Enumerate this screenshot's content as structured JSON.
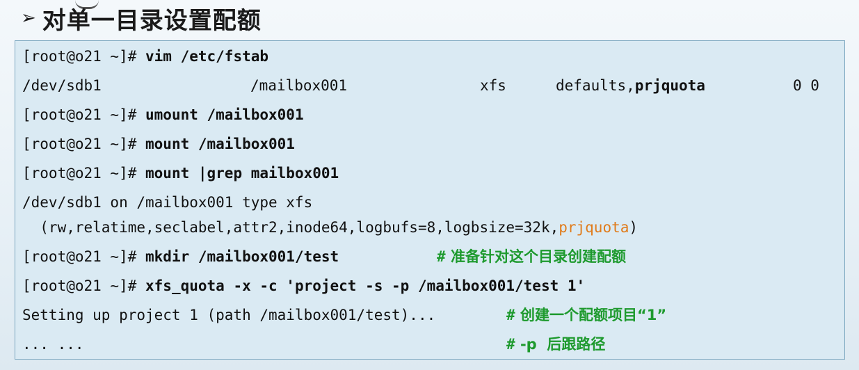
{
  "slide": {
    "bullet": "➢",
    "title": "对单一目录设置配额"
  },
  "terminal": {
    "prompt": "[root@o21 ~]# ",
    "line1_cmd": "vim /etc/fstab",
    "fstab": {
      "device": "/dev/sdb1",
      "mountpoint": "/mailbox001",
      "fstype": "xfs",
      "options_prefix": "defaults,",
      "options_quota": "prjquota",
      "dump_pass": "0 0"
    },
    "line3_cmd": "umount /mailbox001",
    "line4_cmd": "mount /mailbox001",
    "line5_cmd": "mount |grep mailbox001",
    "mount_out1": "/dev/sdb1 on /mailbox001 type xfs",
    "mount_out2_prefix": "  (rw,relatime,seclabel,attr2,inode64,logbufs=8,logbsize=32k,",
    "mount_out2_quota": "prjquota",
    "mount_out2_suffix": ")",
    "line8_cmd": "mkdir /mailbox001/test",
    "line8_comment": "准备针对这个目录创建配额",
    "line9_cmd": "xfs_quota -x -c 'project -s -p /mailbox001/test 1'",
    "line10_out": "Setting up project 1 (path /mailbox001/test)...",
    "line10_comment": "创建一个配额项目“1”",
    "line11_out": "... ...",
    "line11_comment": "-p  后跟路径",
    "hash": "#"
  }
}
